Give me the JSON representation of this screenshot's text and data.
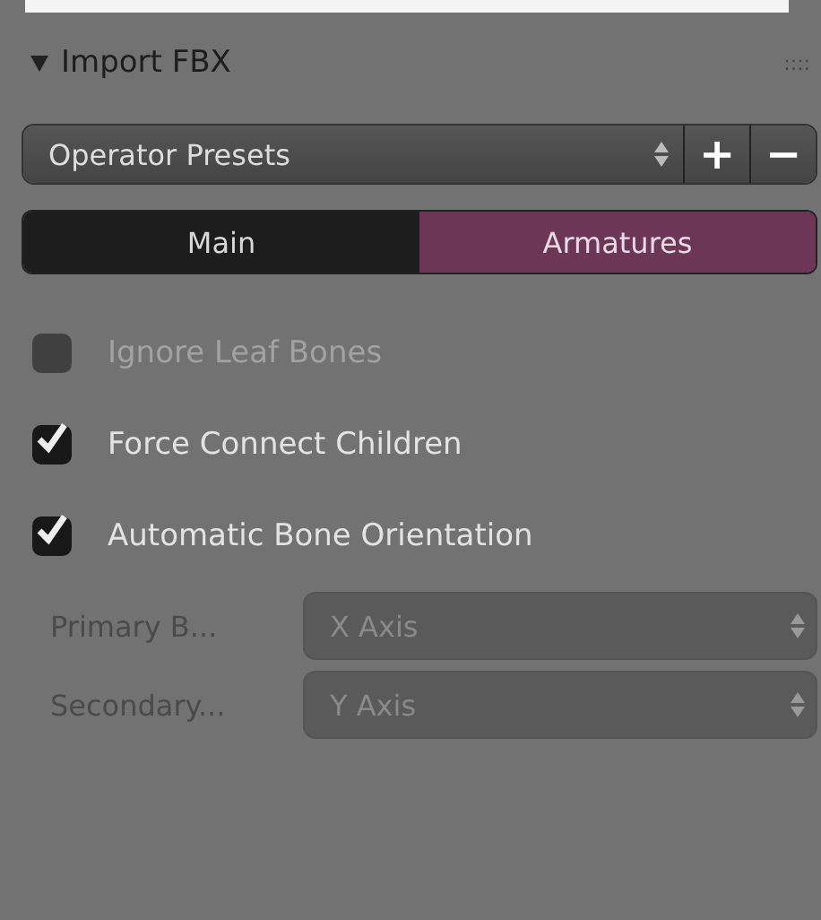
{
  "panel": {
    "title": "Import FBX",
    "expanded": true,
    "grip": "::::"
  },
  "presets": {
    "label": "Operator Presets",
    "add": "+",
    "remove": "−"
  },
  "tabs": [
    {
      "label": "Main",
      "selected": false
    },
    {
      "label": "Armatures",
      "selected": true
    }
  ],
  "options": [
    {
      "label": "Ignore Leaf Bones",
      "checked": false,
      "disabled": true
    },
    {
      "label": "Force Connect Children",
      "checked": true,
      "disabled": false
    },
    {
      "label": "Automatic Bone Orientation",
      "checked": true,
      "disabled": false
    }
  ],
  "fields": [
    {
      "label": "Primary B...",
      "value": "X Axis",
      "disabled": true
    },
    {
      "label": "Secondary...",
      "value": "Y Axis",
      "disabled": true
    }
  ]
}
